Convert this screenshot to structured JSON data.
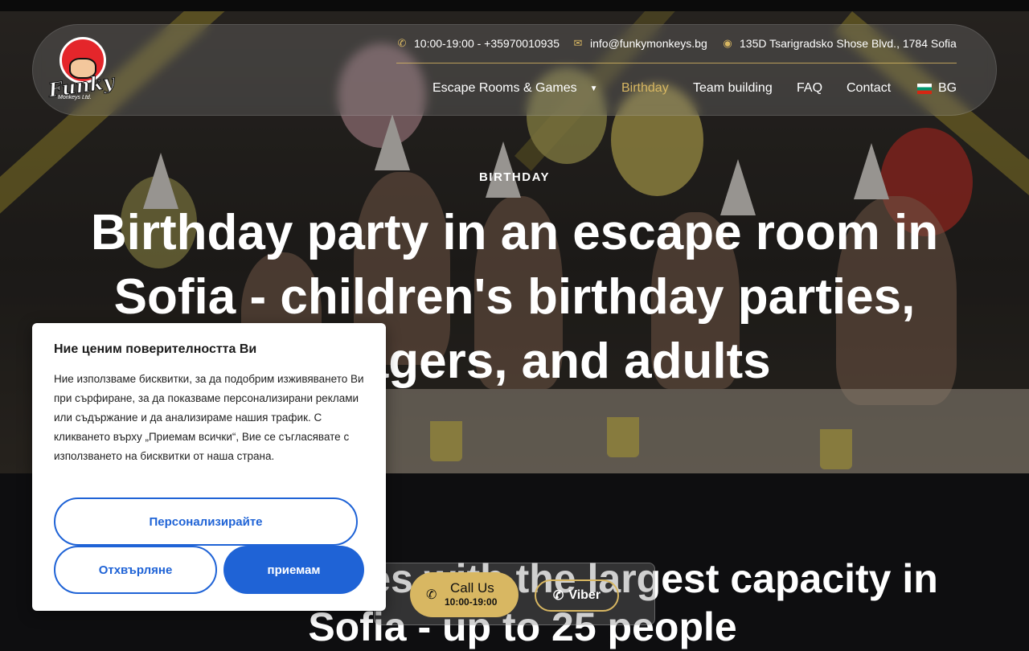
{
  "header": {
    "logo_text": "Funky",
    "logo_sub": "Monkeys Ltd.",
    "phone": "10:00-19:00 - +35970010935",
    "email": "info@funkymonkeys.bg",
    "address": "135D Tsarigradsko Shose Blvd., 1784 Sofia",
    "nav": {
      "escape": "Escape Rooms & Games",
      "birthday": "Birthday",
      "team": "Team building",
      "faq": "FAQ",
      "contact": "Contact",
      "lang": "BG"
    }
  },
  "hero": {
    "eyebrow": "BIRTHDAY",
    "title": "Birthday party in an escape room in Sofia - children's birthday parties, teenagers, and adults"
  },
  "section2": {
    "title": "Birthday parties with the largest capacity in Sofia - up to 25 people"
  },
  "cookie": {
    "title": "Ние ценим поверителността Ви",
    "body": "Ние използваме бисквитки, за да подобрим изживяването Ви при сърфиране, за да показваме персонализирани реклами или съдържание и да анализираме нашия трафик. С кликването върху „Приемам всички“, Вие се съгласявате с използването на бисквитки от наша страна.",
    "customize": "Персонализирайте",
    "reject": "Отхвърляне",
    "accept": "приемам"
  },
  "cta": {
    "call_title": "Call Us",
    "call_hours": "10:00-19:00",
    "viber": "Viber"
  },
  "colors": {
    "gold": "#d8b762",
    "blue": "#1f63d6"
  },
  "icons": {
    "phone": "phone-icon",
    "mail": "mail-icon",
    "location": "location-pin-icon",
    "viber": "viber-icon"
  }
}
